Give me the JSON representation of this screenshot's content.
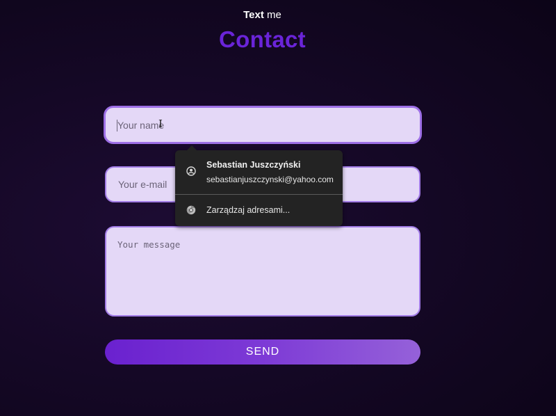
{
  "header": {
    "small_bold": "Text",
    "small_rest": "me",
    "title": "Contact"
  },
  "form": {
    "name_placeholder": "Your name",
    "email_placeholder": "Your e-mail",
    "message_placeholder": "Your message",
    "send_label": "SEND"
  },
  "autofill": {
    "profile_name": "Sebastian Juszczyński",
    "profile_email": "sebastianjuszczynski@yahoo.com",
    "profile_icon": "account-circle-icon",
    "manage_label": "Zarządzaj adresami...",
    "manage_icon": "chrome-icon"
  },
  "colors": {
    "accent": "#6a24d8",
    "field_bg": "#e4d8f7",
    "field_border": "#a27ce6",
    "button_start": "#6a21cf",
    "button_end": "#9561d9",
    "popup_bg": "#232323"
  }
}
